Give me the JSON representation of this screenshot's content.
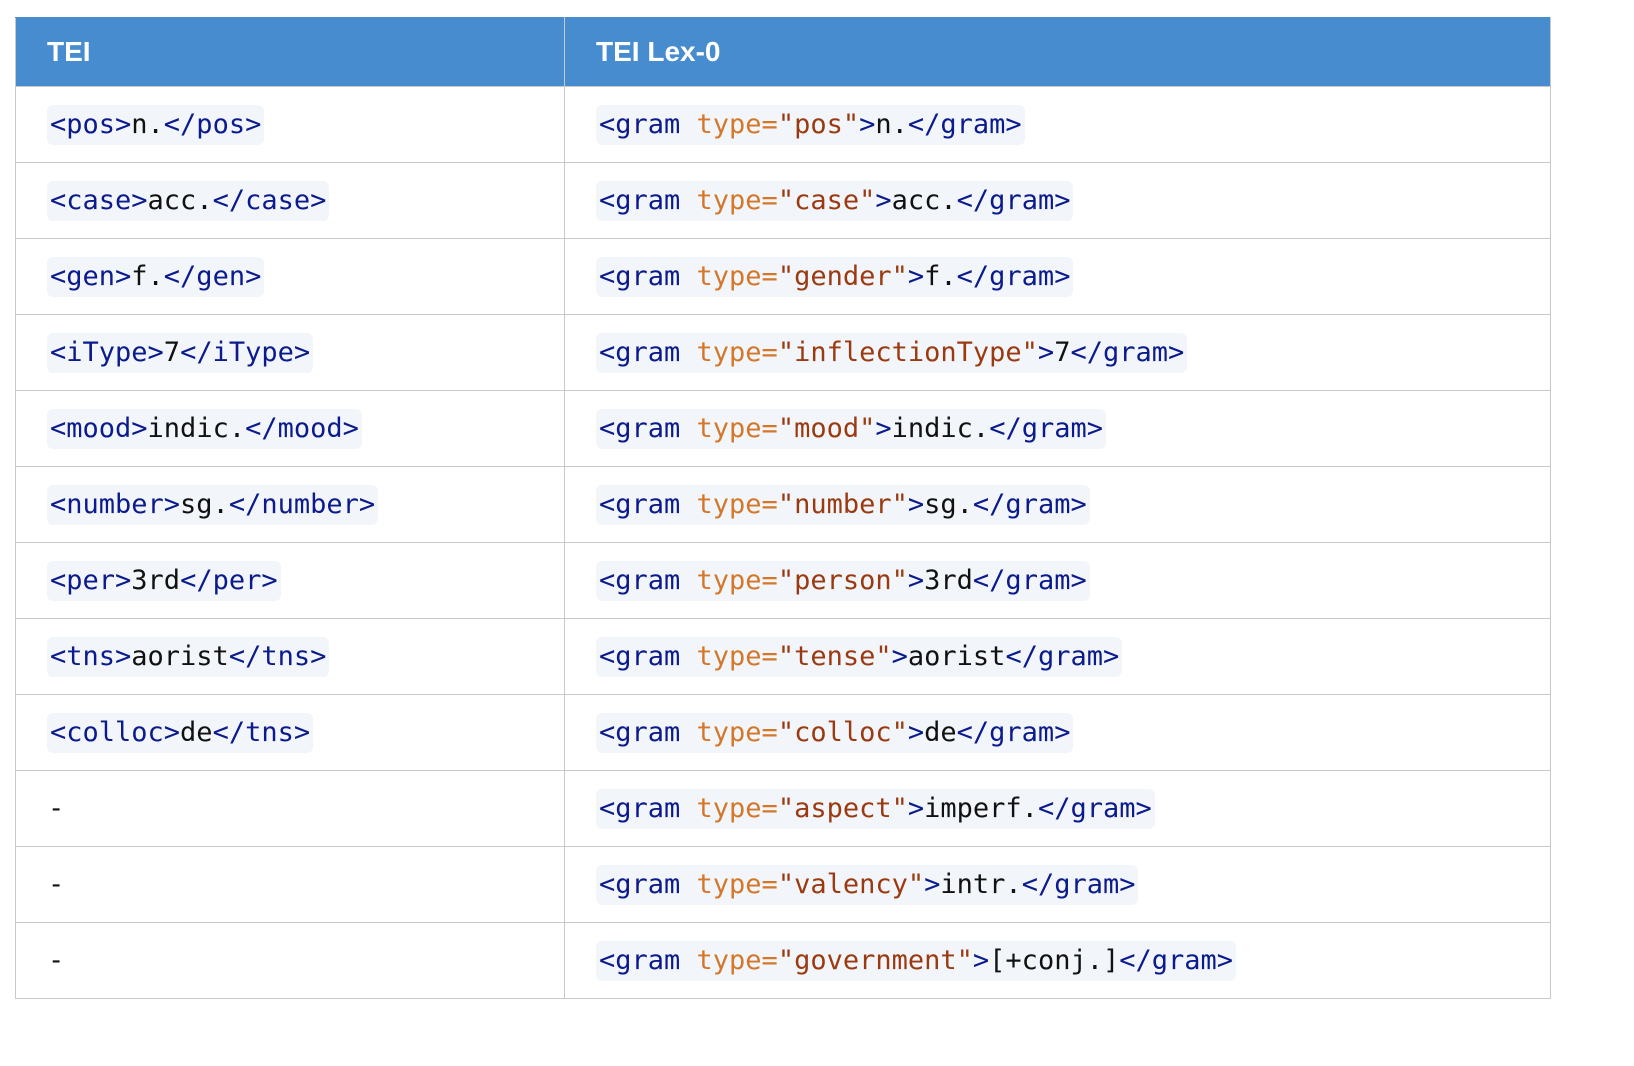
{
  "table": {
    "headers": [
      "TEI",
      "TEI Lex-0"
    ],
    "rows": [
      {
        "tei": {
          "open": "<pos>",
          "text": "n.",
          "close": "</pos>"
        },
        "lex0": {
          "open": "<gram",
          "attr": " type=",
          "val": "\"pos\"",
          "gt": ">",
          "text": "n.",
          "close": "</gram>"
        }
      },
      {
        "tei": {
          "open": "<case>",
          "text": "acc.",
          "close": "</case>"
        },
        "lex0": {
          "open": "<gram",
          "attr": " type=",
          "val": "\"case\"",
          "gt": ">",
          "text": "acc.",
          "close": "</gram>"
        }
      },
      {
        "tei": {
          "open": "<gen>",
          "text": "f.",
          "close": "</gen>"
        },
        "lex0": {
          "open": "<gram",
          "attr": " type=",
          "val": "\"gender\"",
          "gt": ">",
          "text": "f.",
          "close": "</gram>"
        }
      },
      {
        "tei": {
          "open": "<iType>",
          "text": "7",
          "close": "</iType>"
        },
        "lex0": {
          "open": "<gram",
          "attr": " type=",
          "val": "\"inflectionType\"",
          "gt": ">",
          "text": "7",
          "close": "</gram>"
        }
      },
      {
        "tei": {
          "open": "<mood>",
          "text": "indic.",
          "close": "</mood>"
        },
        "lex0": {
          "open": "<gram",
          "attr": " type=",
          "val": "\"mood\"",
          "gt": ">",
          "text": "indic.",
          "close": "</gram>"
        }
      },
      {
        "tei": {
          "open": "<number>",
          "text": "sg.",
          "close": "</number>"
        },
        "lex0": {
          "open": "<gram",
          "attr": " type=",
          "val": "\"number\"",
          "gt": ">",
          "text": "sg.",
          "close": "</gram>"
        }
      },
      {
        "tei": {
          "open": "<per>",
          "text": "3rd",
          "close": "</per>"
        },
        "lex0": {
          "open": "<gram",
          "attr": " type=",
          "val": "\"person\"",
          "gt": ">",
          "text": "3rd",
          "close": "</gram>"
        }
      },
      {
        "tei": {
          "open": "<tns>",
          "text": "aorist",
          "close": "</tns>"
        },
        "lex0": {
          "open": "<gram",
          "attr": " type=",
          "val": "\"tense\"",
          "gt": ">",
          "text": "aorist",
          "close": "</gram>"
        }
      },
      {
        "tei": {
          "open": "<colloc>",
          "text": "de",
          "close": "</tns>"
        },
        "lex0": {
          "open": "<gram",
          "attr": " type=",
          "val": "\"colloc\"",
          "gt": ">",
          "text": "de",
          "close": "</gram>"
        }
      },
      {
        "tei": {
          "dash": "-"
        },
        "lex0": {
          "open": "<gram",
          "attr": " type=",
          "val": "\"aspect\"",
          "gt": ">",
          "text": "imperf.",
          "close": "</gram>"
        }
      },
      {
        "tei": {
          "dash": "-"
        },
        "lex0": {
          "open": "<gram",
          "attr": " type=",
          "val": "\"valency\"",
          "gt": ">",
          "text": "intr.",
          "close": "</gram>"
        }
      },
      {
        "tei": {
          "dash": "-"
        },
        "lex0": {
          "open": "<gram",
          "attr": " type=",
          "val": "\"government\"",
          "gt": ">",
          "text": "[+conj.]",
          "close": "</gram>"
        }
      }
    ]
  },
  "colors": {
    "header_bg": "#468ccf",
    "tag": "#0b1a8c",
    "attribute": "#d4772b",
    "attribute_value": "#9b3a10",
    "code_bg": "#f2f6fa"
  }
}
